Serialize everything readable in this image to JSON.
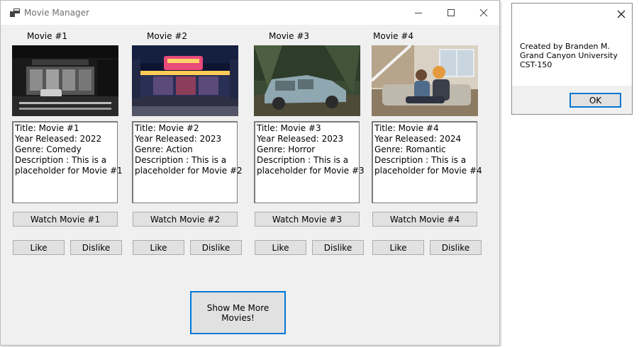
{
  "window": {
    "title": "Movie Manager",
    "accent": "#0078d7"
  },
  "movies": [
    {
      "label": "Movie #1",
      "image": "city-night-street-photo",
      "info": [
        "Title: Movie #1",
        "Year Released:  2022",
        "Genre: Comedy",
        "Description : This is a",
        "placeholder for Movie #1"
      ],
      "watch": "Watch Movie #1",
      "like": "Like",
      "dislike": "Dislike"
    },
    {
      "label": "Movie #2",
      "image": "neon-theater-night-photo",
      "info": [
        "Title: Movie #2",
        "Year Released:  2023",
        "Genre: Action",
        "Description : This is a",
        "placeholder for Movie #2"
      ],
      "watch": "Watch Movie #2",
      "like": "Like",
      "dislike": "Dislike"
    },
    {
      "label": "Movie #3",
      "image": "abandoned-car-forest-photo",
      "info": [
        "Title: Movie #3",
        "Year Released:  2023",
        "Genre: Horror",
        "Description : This is a",
        "placeholder for Movie #3"
      ],
      "watch": "Watch Movie #3",
      "like": "Like",
      "dislike": "Dislike"
    },
    {
      "label": "Movie #4",
      "image": "couple-on-couch-photo",
      "info": [
        "Title: Movie #4",
        "Year Released:  2024",
        "Genre: Romantic",
        "Description : This is a",
        "placeholder for Movie #4"
      ],
      "watch": "Watch Movie #4",
      "like": "Like",
      "dislike": "Dislike"
    }
  ],
  "more_button": "Show Me More Movies!",
  "message_box": {
    "lines": [
      "Created by Branden M.",
      "Grand Canyon University",
      "CST-150"
    ],
    "ok": "OK"
  }
}
